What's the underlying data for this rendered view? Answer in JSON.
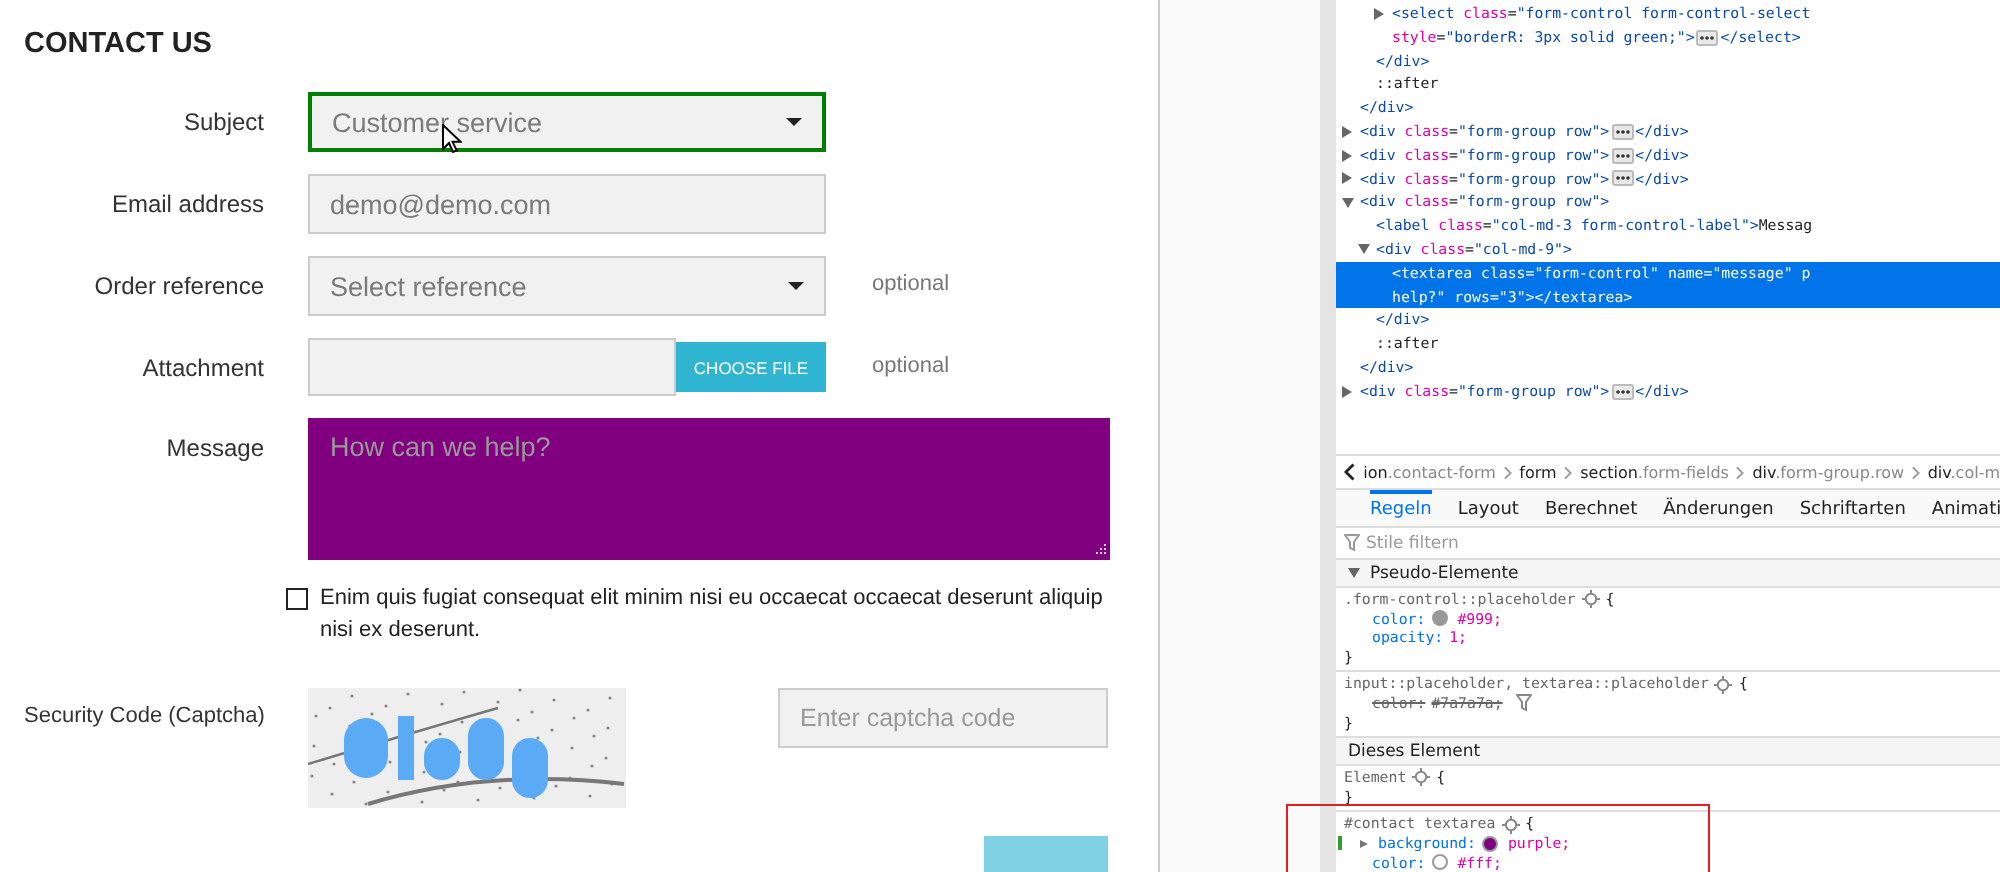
{
  "form": {
    "title": "CONTACT US",
    "fields": [
      {
        "kind": "select",
        "label": "Subject",
        "value": "Customer service",
        "highlighted": true
      },
      {
        "kind": "input",
        "label": "Email address",
        "value": "demo@demo.com",
        "highlighted": false
      },
      {
        "kind": "select",
        "label": "Order reference",
        "value": "Select reference",
        "note": "optional",
        "highlighted": false
      },
      {
        "kind": "file",
        "label": "Attachment",
        "button": "CHOOSE FILE",
        "note": "optional",
        "highlighted": false
      },
      {
        "kind": "textarea",
        "label": "Message",
        "placeholder": "How can we help?",
        "highlighted": false
      }
    ],
    "consent": {
      "checked": false,
      "text": "Enim quis fugiat consequat elit minim nisi eu occaecat occaecat deserunt aliquip nisi ex deserunt."
    },
    "captcha": {
      "label": "Security Code (Captcha)",
      "placeholder": "Enter captcha code"
    }
  },
  "dom_tree": [
    {
      "children": [
        {
          "children": [
            {
              "text": "<select class=\"form-control form-control-select",
              "text2": "style=\"borderR: 3px solid green;\">",
              "tail": "</select>",
              "expanded": false,
              "selected": false
            }
          ],
          "closing": "</div>"
        },
        {
          "text": "::after",
          "selected": false
        }
      ],
      "closing": "</div>"
    },
    {
      "text": "<div class=\"form-group row\">",
      "tail": "</div>",
      "expanded": false,
      "selected": false
    },
    {
      "text": "<div class=\"form-group row\">",
      "tail": "</div>",
      "expanded": false,
      "selected": false
    },
    {
      "text": "<div class=\"form-group row\">",
      "tail": "</div>",
      "expanded": false,
      "selected": false
    },
    {
      "text": "<div class=\"form-group row\">",
      "expanded": true,
      "selected": false,
      "closing": "</div>",
      "children": [
        {
          "text": "<label class=\"col-md-3 form-control-label\">Messag",
          "selected": false
        },
        {
          "text": "<div class=\"col-md-9\">",
          "expanded": true,
          "selected": false,
          "closing": "</div>",
          "children": [
            {
              "text": "<textarea class=\"form-control\" name=\"message\" p",
              "text2": "help?\" rows=\"3\"></textarea>",
              "selected": true
            }
          ]
        },
        {
          "text": "::after",
          "selected": false
        }
      ]
    },
    {
      "text": "<div class=\"form-group row\">",
      "tail": "</div>",
      "expanded": false,
      "selected": false
    }
  ],
  "breadcrumb": [
    {
      "tag": "ion",
      "cls": ".contact-form"
    },
    {
      "tag": "form"
    },
    {
      "tag": "section",
      "cls": ".form-fields"
    },
    {
      "tag": "div",
      "cls": ".form-group.row"
    },
    {
      "tag": "div",
      "cls": ".col-m"
    }
  ],
  "tabs": [
    {
      "label": "Regeln",
      "selected": true
    },
    {
      "label": "Layout",
      "selected": false
    },
    {
      "label": "Berechnet",
      "selected": false
    },
    {
      "label": "Änderungen",
      "selected": false
    },
    {
      "label": "Schriftarten",
      "selected": false
    },
    {
      "label": "Animati",
      "selected": false
    }
  ],
  "filter": {
    "placeholder": "Stile filtern"
  },
  "rule_sections": [
    {
      "title": "Pseudo-Elemente",
      "expanded": true,
      "rules": [
        {
          "selector": ".form-control::placeholder",
          "open": "{",
          "close": "}",
          "decls": [
            {
              "prop": "color:",
              "color": "#999999",
              "value": "#999;",
              "overridden": false
            },
            {
              "prop": "opacity:",
              "value": "1;",
              "overridden": false
            }
          ]
        },
        {
          "selector": "input::placeholder, textarea::placeholder",
          "open": "{",
          "close": "}",
          "decls": [
            {
              "prop": "color:",
              "value": "#7a7a7a;",
              "overridden": true
            }
          ]
        }
      ]
    },
    {
      "title": "Dieses Element",
      "rules": [
        {
          "selector": "Element",
          "open": "{",
          "close": "}"
        },
        {
          "selector": "#contact textarea",
          "open": "{",
          "changed": true,
          "marked": true,
          "decls": [
            {
              "prop": "background:",
              "color": "#800080",
              "value": "purple;",
              "overridden": false,
              "expandable": true
            },
            {
              "prop": "color:",
              "color": "#ffffff",
              "value": "#fff;",
              "overridden": false
            }
          ]
        }
      ]
    }
  ]
}
